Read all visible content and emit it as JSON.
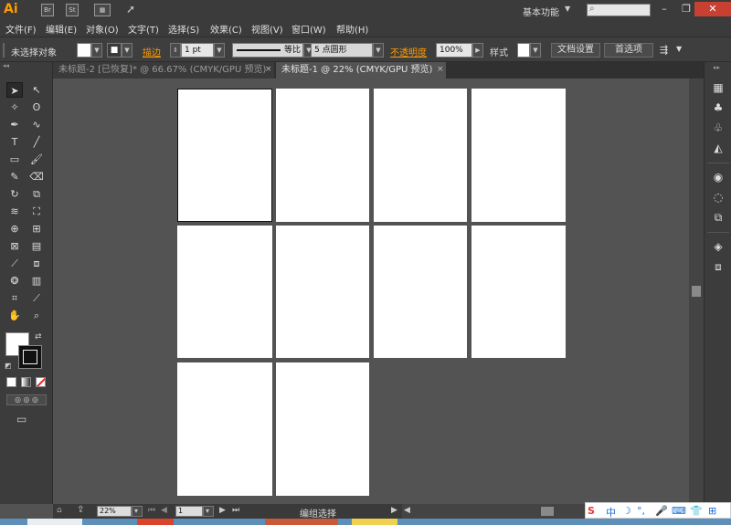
{
  "app": {
    "logo": "Ai"
  },
  "titlebar": {
    "br_icon": "Br",
    "st_icon": "St",
    "workspace": "基本功能",
    "search_placeholder": ""
  },
  "menu": [
    "文件(F)",
    "编辑(E)",
    "对象(O)",
    "文字(T)",
    "选择(S)",
    "效果(C)",
    "视图(V)",
    "窗口(W)",
    "帮助(H)"
  ],
  "control": {
    "selection_status": "未选择对象",
    "stroke_label": "描边",
    "stroke_weight": "1 pt",
    "stroke_style": "等比",
    "brush": "5 点圆形",
    "opacity_label": "不透明度",
    "opacity_value": "100%",
    "style_label": "样式",
    "doc_setup": "文档设置",
    "preferences": "首选项"
  },
  "tabs": [
    {
      "label": "未标题-2 [已恢复]* @ 66.67% (CMYK/GPU 预览)",
      "active": false
    },
    {
      "label": "未标题-1 @ 22% (CMYK/GPU 预览)",
      "active": true
    }
  ],
  "tools": {
    "icons": [
      "selection-icon",
      "direct-selection-icon",
      "magic-wand-icon",
      "lasso-icon",
      "pen-icon",
      "curvature-icon",
      "type-icon",
      "line-icon",
      "rectangle-icon",
      "paintbrush-icon",
      "pencil-icon",
      "eraser-icon",
      "rotate-icon",
      "scale-icon",
      "warp-icon",
      "free-transform-icon",
      "shape-builder-icon",
      "perspective-icon",
      "mesh-icon",
      "gradient-icon",
      "eyedropper-icon",
      "blend-icon",
      "symbol-sprayer-icon",
      "graph-icon",
      "artboard-icon",
      "slice-icon",
      "hand-icon",
      "zoom-icon"
    ]
  },
  "right_panel": {
    "icons": [
      "swatches-icon",
      "brushes-icon",
      "symbols-icon",
      "graphic-styles-icon",
      "appearance-icon",
      "transparency-icon",
      "transform-icon",
      "layers-icon",
      "artboards-icon"
    ]
  },
  "artboards": {
    "count": 10,
    "selected_index": 0
  },
  "status": {
    "zoom": "22%",
    "artboard_number": "1",
    "tool_status": "编组选择"
  },
  "ime": {
    "lang": "中"
  },
  "colors": {
    "app_bg": "#535353",
    "panel_bg": "#3c3c3c",
    "accent": "#ff9a00",
    "close_button": "#c84031"
  }
}
